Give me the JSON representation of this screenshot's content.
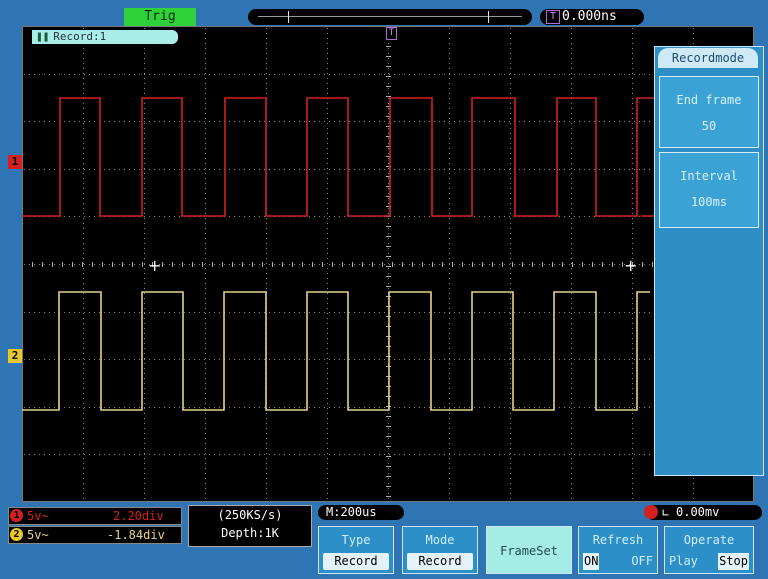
{
  "top": {
    "trig_status": "Trig",
    "trigger_delay": "0.000ns",
    "trigger_marker": "T",
    "record_tag": "Record:1"
  },
  "channels": {
    "ch1_marker": "1",
    "ch2_marker": "2"
  },
  "menu": {
    "title": "Recordmode",
    "end_frame_label": "End frame",
    "end_frame_value": "50",
    "interval_label": "Interval",
    "interval_value": "100ms"
  },
  "status": {
    "ch1_coupling": "5v~",
    "ch1_offset": "2.20div",
    "ch1_badge": "1",
    "ch2_coupling": "5v~",
    "ch2_offset": "-1.84div",
    "ch2_badge": "2",
    "sample_rate": "(250KS/s)",
    "depth": "Depth:1K",
    "timebase": "M:200us",
    "trigger_level": "0.00mv"
  },
  "buttons": {
    "type_label": "Type",
    "type_value": "Record",
    "mode_label": "Mode",
    "mode_value": "Record",
    "frameset_label": "FrameSet",
    "refresh_label": "Refresh",
    "refresh_on": "ON",
    "refresh_off": "OFF",
    "operate_label": "Operate",
    "operate_play": "Play",
    "operate_stop": "Stop"
  },
  "colors": {
    "ch1": "#d42020",
    "ch2": "#e6c82e",
    "menu_bg": "#2e8fc7",
    "frame_bg": "#2f74b3"
  }
}
